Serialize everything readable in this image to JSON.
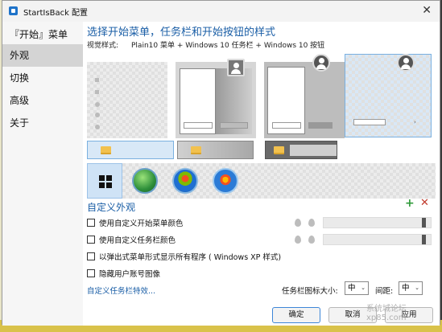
{
  "window": {
    "title": "StartIsBack 配置",
    "close_glyph": "✕"
  },
  "sidebar": {
    "items": [
      {
        "label": "『开始』菜单"
      },
      {
        "label": "外观"
      },
      {
        "label": "切换"
      },
      {
        "label": "高级"
      },
      {
        "label": "关于"
      }
    ],
    "active_index": 1
  },
  "main": {
    "section_title": "选择开始菜单，任务栏和开始按钮的样式",
    "visual_style_label": "视觉样式:",
    "visual_style_value": "Plain10 菜单 + Windows 10 任务栏 + Windows 10 按钮",
    "menu_previews": [
      "Plain10 light",
      "Plain10 gray",
      "Plain10 white",
      "Plain10 checker"
    ],
    "selected_menu_preview": 3,
    "taskbar_previews": [
      "Windows 10 light",
      "Windows 10 gray",
      "Windows 10 dark"
    ],
    "selected_taskbar_preview": 0,
    "orbs": [
      {
        "name": "windows10-logo-icon"
      },
      {
        "name": "green-orb-icon"
      },
      {
        "name": "windows7-orb-icon"
      },
      {
        "name": "vista-orb-icon"
      }
    ],
    "selected_orb": 0,
    "custom_title": "自定义外观",
    "add_glyph": "+",
    "remove_glyph": "✕",
    "options": [
      {
        "label": "使用自定义开始菜单颜色",
        "checked": false
      },
      {
        "label": "使用自定义任务栏颜色",
        "checked": false
      },
      {
        "label": "以弹出式菜单形式显示所有程序  ( Windows XP 样式)",
        "checked": false
      },
      {
        "label": "隐藏用户账号图像",
        "checked": false
      }
    ],
    "sliders": [
      {
        "level": 0.95
      },
      {
        "level": 0.95
      }
    ],
    "taskbar_effects_link": "自定义任务栏特效...",
    "icon_size_label": "任务栏图标大小:",
    "icon_size_value": "中",
    "spacing_label": "间距:",
    "spacing_value": "中",
    "dropdown_glyph": "⌄"
  },
  "footer": {
    "ok": "确定",
    "cancel": "取消",
    "apply": "应用"
  },
  "watermark": "系统城论坛 xp85.com"
}
